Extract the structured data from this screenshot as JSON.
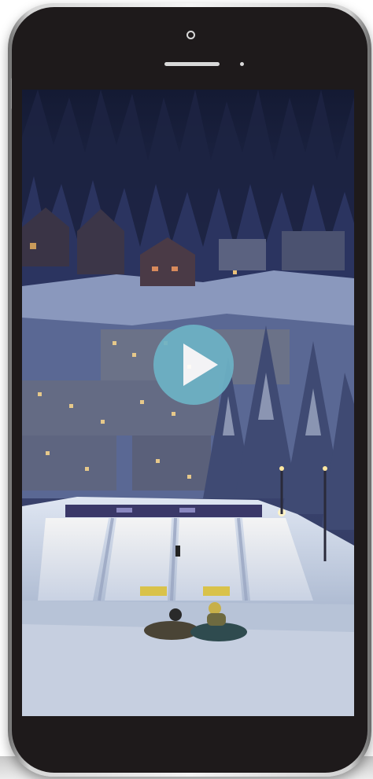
{
  "device": {
    "frame_color": "#e2e2e2",
    "bezel_color": "#1e1a1b"
  },
  "video": {
    "scene_description_icons": [
      "snow-tubing-hill",
      "ski-village",
      "pine-forest"
    ],
    "play_button": {
      "icon": "play-icon",
      "color": "#6db3c6"
    }
  }
}
